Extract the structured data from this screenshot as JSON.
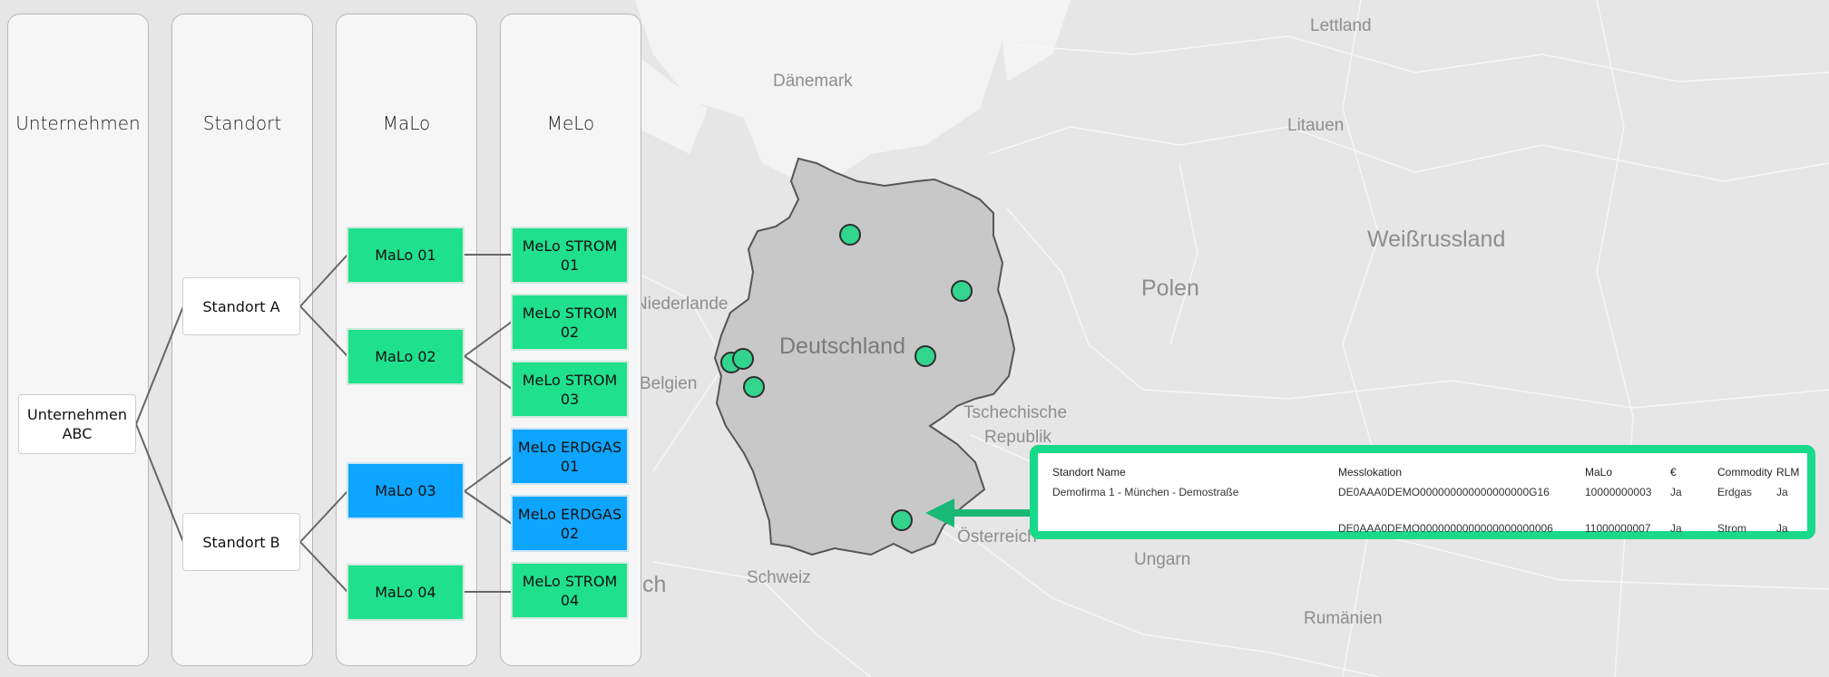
{
  "columns": {
    "unternehmen": "Unternehmen",
    "standort": "Standort",
    "malo": "MaLo",
    "melo": "MeLo"
  },
  "nodes": {
    "company": "Unternehmen ABC",
    "standort_a": "Standort A",
    "standort_b": "Standort B",
    "malo_01": "MaLo 01",
    "malo_02": "MaLo 02",
    "malo_03": "MaLo 03",
    "malo_04": "MaLo 04",
    "melo_strom_01": "MeLo STROM 01",
    "melo_strom_02": "MeLo STROM 02",
    "melo_strom_03": "MeLo STROM 03",
    "melo_erdgas_01": "MeLo ERDGAS 01",
    "melo_erdgas_02": "MeLo ERDGAS 02",
    "melo_strom_04": "MeLo STROM 04"
  },
  "colors": {
    "strom": "#1fe08c",
    "erdgas": "#0ea5ff",
    "highlight": "#19d98a",
    "map_bg": "#e6e6e6",
    "germany": "#c9c9c9"
  },
  "map_labels": {
    "lettland": "Lettland",
    "daenemark": "Dänemark",
    "litauen": "Litauen",
    "weissrussland": "Weißrussland",
    "polen": "Polen",
    "niederlande": "Niederlande",
    "deutschland": "Deutschland",
    "belgien": "Belgien",
    "tschechische": "Tschechische",
    "republik": "Republik",
    "oesterreich": "Österreich",
    "ungarn": "Ungarn",
    "schweiz": "Schweiz",
    "rumaenien": "Rumänien",
    "frankreich": "ch"
  },
  "table": {
    "headers": {
      "standort_name": "Standort Name",
      "messlokation": "Messlokation",
      "malo": "MaLo",
      "euro": "€",
      "commodity": "Commodity",
      "rlm": "RLM"
    },
    "rows": [
      {
        "standort_name": "Demofirma 1 - München - Demostraße",
        "messlokation": "DE0AAA0DEMO000000000000000000G16",
        "malo": "10000000003",
        "euro": "Ja",
        "commodity": "Erdgas",
        "rlm": "Ja"
      },
      {
        "standort_name": "",
        "messlokation": "DE0AAA0DEMO0000000000000000000006",
        "malo": "11000000007",
        "euro": "Ja",
        "commodity": "Strom",
        "rlm": "Ja"
      }
    ]
  }
}
